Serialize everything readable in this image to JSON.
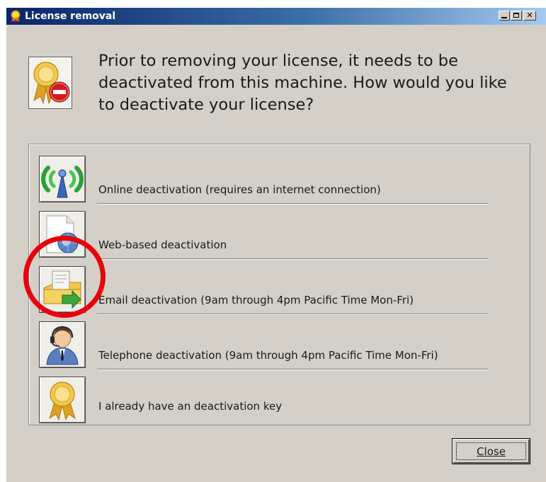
{
  "window": {
    "title": "License removal",
    "controls": [
      "minimize",
      "maximize",
      "close"
    ]
  },
  "header": {
    "icon": "license-remove-icon",
    "message": "Prior to removing your license, it needs to be deactivated from this machine.  How would you like to deactivate your license?"
  },
  "options": [
    {
      "label": "Online deactivation (requires an internet connection)",
      "icon": "online-wireless-icon"
    },
    {
      "label": "Web-based deactivation",
      "icon": "web-globe-icon"
    },
    {
      "label": "Email deactivation (9am through 4pm Pacific Time Mon-Fri)",
      "icon": "email-icon"
    },
    {
      "label": "Telephone deactivation (9am through 4pm Pacific Time Mon-Fri)",
      "icon": "telephone-person-icon"
    },
    {
      "label": "I already have an deactivation key",
      "icon": "license-ribbon-icon"
    }
  ],
  "footer": {
    "close_label": "Close"
  },
  "colors": {
    "titlebar_start": "#0a246a",
    "titlebar_end": "#a6caf0",
    "dialog_bg": "#d4d0c8",
    "annotation": "#e8000b"
  }
}
